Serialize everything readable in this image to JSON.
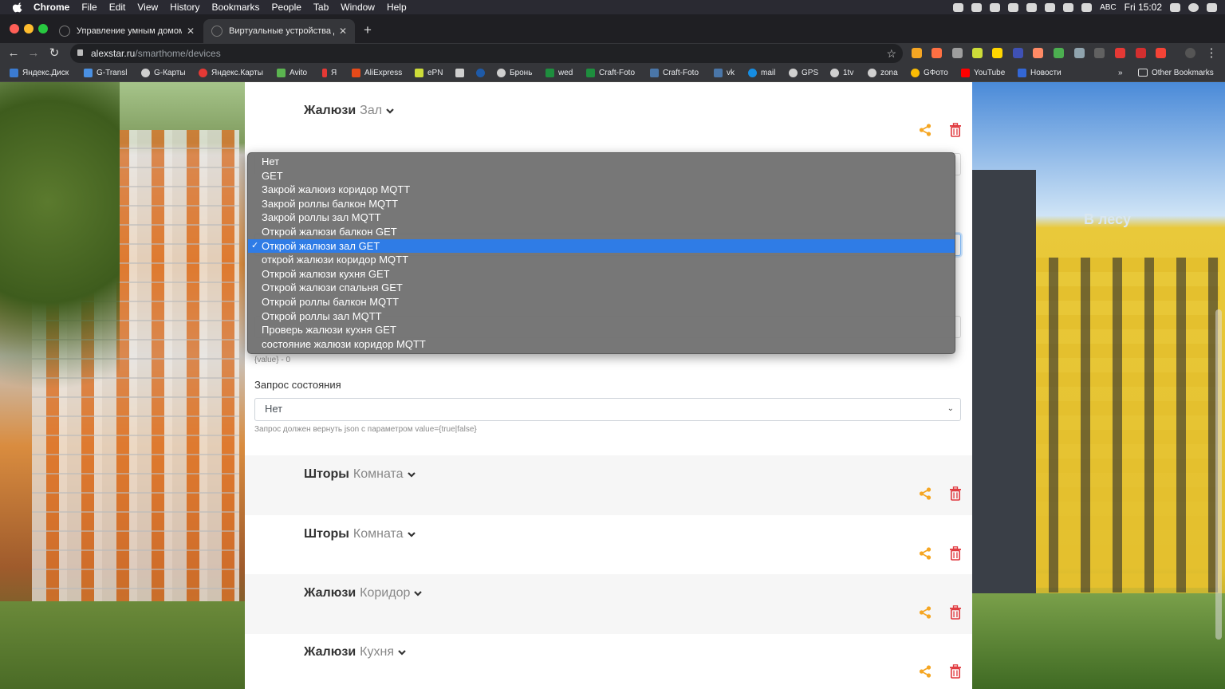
{
  "menubar": {
    "app": "Chrome",
    "items": [
      "File",
      "Edit",
      "View",
      "History",
      "Bookmarks",
      "People",
      "Tab",
      "Window",
      "Help"
    ],
    "input_source": "ABC",
    "clock": "Fri 15:02"
  },
  "tabs": [
    {
      "label": "Управление умным домом",
      "active": false
    },
    {
      "label": "Виртуальные устройства дом",
      "active": true
    }
  ],
  "omnibox": {
    "host": "alexstar.ru",
    "path": "/smarthome/devices"
  },
  "bookmarks": [
    {
      "label": "Яндекс.Диск",
      "color": "#3b7bd1"
    },
    {
      "label": "G-Transl",
      "color": "#4a90e2"
    },
    {
      "label": "G-Карты",
      "color": "#cfcfcf"
    },
    {
      "label": "Яндекс.Карты",
      "color": "#e53935"
    },
    {
      "label": "Avito",
      "color": "#5bb450"
    },
    {
      "label": "Я",
      "color": "#e53935"
    },
    {
      "label": "AliExpress",
      "color": "#e64a19"
    },
    {
      "label": "ePN",
      "color": "#cddc39"
    },
    {
      "label": "",
      "color": "#cfcfcf"
    },
    {
      "label": "",
      "color": "#1e5aa8"
    },
    {
      "label": "Бронь",
      "color": "#cfcfcf"
    },
    {
      "label": "wed",
      "color": "#1e8e3e"
    },
    {
      "label": "Craft-Foto",
      "color": "#1e8e3e"
    },
    {
      "label": "Craft-Foto",
      "color": "#4a76a8"
    },
    {
      "label": "vk",
      "color": "#4a76a8"
    },
    {
      "label": "mail",
      "color": "#168de2"
    },
    {
      "label": "GPS",
      "color": "#cfcfcf"
    },
    {
      "label": "1tv",
      "color": "#cfcfcf"
    },
    {
      "label": "zona",
      "color": "#cfcfcf"
    },
    {
      "label": "GФото",
      "color": "#fbbc04"
    },
    {
      "label": "YouTube",
      "color": "#ff0000"
    },
    {
      "label": "Новости",
      "color": "#3367d6"
    }
  ],
  "bookmarks_overflow": "»",
  "other_bookmarks": "Other Bookmarks",
  "devices": [
    {
      "type": "Жалюзи",
      "room": "Зал"
    },
    {
      "type": "Шторы",
      "room": "Комната"
    },
    {
      "type": "Шторы",
      "room": "Комната"
    },
    {
      "type": "Жалюзи",
      "room": "Коридор"
    },
    {
      "type": "Жалюзи",
      "room": "Кухня"
    }
  ],
  "form": {
    "value_hint": "{value} - 0",
    "status_label": "Запрос состояния",
    "status_value": "Нет",
    "status_hint": "Запрос должен вернуть json с параметром value={true|false}"
  },
  "dropdown": {
    "options": [
      "Нет",
      "GET",
      "Закрой жалюиз коридор MQTT",
      "Закрой роллы балкон MQTT",
      "Закрой роллы зал MQTT",
      "Открой жалюзи балкон GET",
      "Открой жалюзи зал GET",
      "открой жалюзи коридор MQTT",
      "Открой жалюзи кухня GET",
      "Открой жалюзи спальня GET",
      "Открой роллы балкон MQTT",
      "Открой роллы зал MQTT",
      "Проверь жалюзи кухня GET",
      "состояние жалюзи коридор MQTT"
    ],
    "selected_index": 6
  },
  "bg_sign": "В лесу",
  "colors": {
    "share": "#f5a623",
    "trash": "#e0393e",
    "selected": "#2f7ce6",
    "menu_bg": "#737373"
  }
}
